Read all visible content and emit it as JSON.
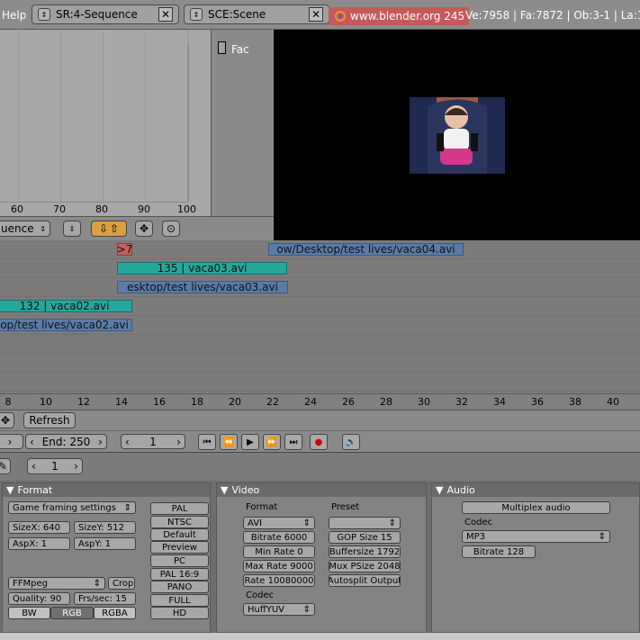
{
  "topbar": {
    "help": "Help",
    "screen_label": "SR:4-Sequence",
    "scene_label": "SCE:Scene",
    "url": "www.blender.org 245",
    "stats": "Ve:7958 | Fa:7872 | Ob:3-1 | La:1"
  },
  "graph": {
    "ticks": [
      "60",
      "70",
      "80",
      "90",
      "100"
    ]
  },
  "sidepanel": {
    "fac_label": "Fac"
  },
  "view_header": {
    "sequence_menu": "uence"
  },
  "sequencer": {
    "marker": ">7",
    "strips": [
      {
        "label": "ow/Desktop/test lives/vaca04.avi"
      },
      {
        "label": "135 | vaca03.avi"
      },
      {
        "label": "esktop/test lives/vaca03.avi"
      },
      {
        "label": "132 | vaca02.avi"
      },
      {
        "label": "op/test lives/vaca02.avi"
      }
    ]
  },
  "ruler": {
    "ticks": [
      "8",
      "10",
      "12",
      "14",
      "16",
      "18",
      "20",
      "22",
      "24",
      "26",
      "28",
      "30",
      "32",
      "34",
      "36",
      "38",
      "40"
    ]
  },
  "bar3": {
    "refresh": "Refresh"
  },
  "bar4": {
    "end": "End: 250",
    "current_frame": "1"
  },
  "bar5": {
    "value": "1"
  },
  "format": {
    "header": "Format",
    "preset_select": "Game framing settings",
    "sizex": "SizeX: 640",
    "sizey": "SizeY: 512",
    "aspx": "AspX: 1",
    "aspy": "AspY: 1",
    "container": "FFMpeg",
    "crop": "Crop",
    "quality": "Quality: 90",
    "fps": "Frs/sec: 15",
    "color_modes": [
      "BW",
      "RGB",
      "RGBA"
    ],
    "presets": [
      "PAL",
      "NTSC",
      "Default",
      "Preview",
      "PC",
      "PAL 16:9",
      "PANO",
      "FULL",
      "HD"
    ]
  },
  "video": {
    "header": "Video",
    "format_label": "Format",
    "preset_label": "Preset",
    "format_value": "AVI",
    "bitrate": "Bitrate 6000",
    "min_rate": "Min Rate 0",
    "max_rate": "Max Rate 9000",
    "rate": "Rate 10080000",
    "gop": "GOP Size 15",
    "buffersize": "Buffersize 1792",
    "mux": "Mux PSize 2048",
    "autosplit": "Autosplit Output",
    "codec_label": "Codec",
    "codec_value": "HuffYUV"
  },
  "audio": {
    "header": "Audio",
    "multiplex": "Multiplex audio",
    "codec_label": "Codec",
    "codec_value": "MP3",
    "bitrate": "Bitrate 128"
  }
}
